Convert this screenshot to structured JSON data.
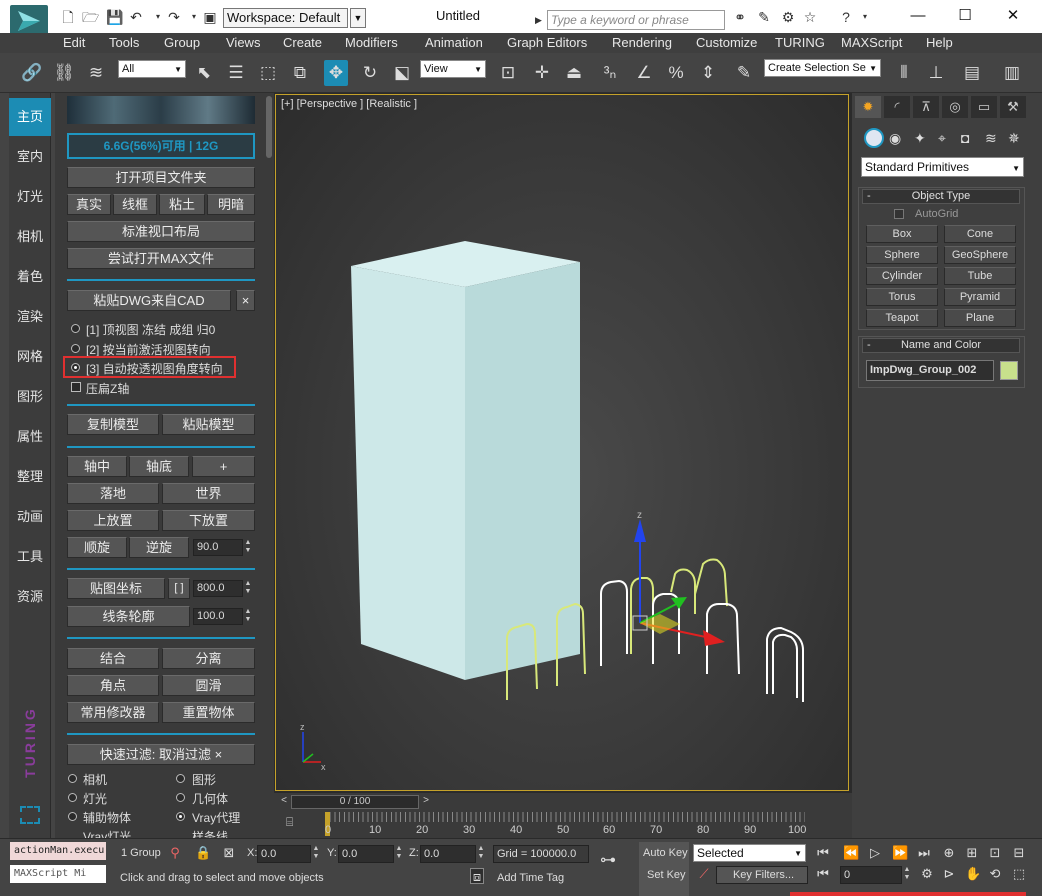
{
  "titlebar": {
    "workspace": "Workspace: Default",
    "title": "Untitled",
    "search_placeholder": "Type a keyword or phrase"
  },
  "menu": [
    "Edit",
    "Tools",
    "Group",
    "Views",
    "Create",
    "Modifiers",
    "Animation",
    "Graph Editors",
    "Rendering",
    "Customize",
    "TURING",
    "MAXScript",
    "Help"
  ],
  "toolbar": {
    "selection_filter": "All",
    "ref_coord": "View",
    "named_selection_placeholder": "Create Selection Se"
  },
  "sidebar": {
    "items": [
      "主页",
      "室内",
      "灯光",
      "相机",
      "着色",
      "渲染",
      "网格",
      "图形",
      "属性",
      "整理",
      "动画",
      "工具",
      "资源"
    ],
    "active_index": 0,
    "brand": "TURING"
  },
  "panel": {
    "memory": "6.6G(56%)可用 | 12G",
    "open_project_folder": "打开项目文件夹",
    "mode_buttons": [
      "真实",
      "线框",
      "粘土",
      "明暗"
    ],
    "standard_layout": "标准视口布局",
    "try_open_max": "尝试打开MAX文件",
    "paste_dwg": "粘贴DWG来自CAD",
    "close_x": "×",
    "options": [
      "[1] 顶视图 冻结 成组 归0",
      "[2] 按当前激活视图转向",
      "[3] 自动按透视图角度转向"
    ],
    "selected_option": 2,
    "flatten_z": "压扁Z轴",
    "copy_model": "复制模型",
    "paste_model": "粘贴模型",
    "pivot_center": "轴中",
    "pivot_bottom": "轴底",
    "plus": "+",
    "to_ground": "落地",
    "world": "世界",
    "place_up": "上放置",
    "place_down": "下放置",
    "rotate_cw": "顺旋",
    "rotate_ccw": "逆旋",
    "rotate_value": "90.0",
    "map_coords": "贴图坐标",
    "map_brackets": "[ ]",
    "map_value": "800.0",
    "spline_outline": "线条轮廓",
    "outline_value": "100.0",
    "combine": "结合",
    "separate": "分离",
    "corner": "角点",
    "smooth": "圆滑",
    "common_modifiers": "常用修改器",
    "reset_object": "重置物体",
    "quick_filter": "快速过滤:  取消过滤 ×",
    "filters": [
      "相机",
      "图形",
      "灯光",
      "几何体",
      "辅助物体",
      "Vray代理",
      "Vray灯光",
      "样条线"
    ],
    "filter_selected": 5
  },
  "viewport": {
    "label": "[+] [Perspective ] [Realistic ]",
    "axis_labels": [
      "z",
      "x"
    ]
  },
  "command_panel": {
    "category": "Standard Primitives",
    "object_type_header": "Object Type",
    "autogrid": "AutoGrid",
    "primitives": [
      "Box",
      "Cone",
      "Sphere",
      "GeoSphere",
      "Cylinder",
      "Tube",
      "Torus",
      "Pyramid",
      "Teapot",
      "Plane"
    ],
    "name_color_header": "Name and Color",
    "object_name": "ImpDwg_Group_002",
    "object_color": "#c8e08c"
  },
  "timeline": {
    "slider": "0 / 100",
    "ticks": [
      "0",
      "10",
      "20",
      "30",
      "40",
      "50",
      "60",
      "70",
      "80",
      "90",
      "100"
    ]
  },
  "status": {
    "maxscript_line1": "actionMan.execu",
    "maxscript_line2": "MAXScript Mi",
    "selection": "1 Group",
    "x_label": "X:",
    "x_value": "0.0",
    "y_label": "Y:",
    "y_value": "0.0",
    "z_label": "Z:",
    "z_value": "0.0",
    "grid": "Grid = 100000.0",
    "prompt": "Click and drag to select and move objects",
    "add_time_tag": "Add Time Tag",
    "auto_key": "Auto Key",
    "set_key": "Set Key",
    "key_mode": "Selected",
    "key_filters": "Key Filters...",
    "frame": "0"
  },
  "colors": {
    "accent": "#1c8cb4",
    "highlight": "#e03030",
    "viewport_border": "#c5a22a"
  }
}
